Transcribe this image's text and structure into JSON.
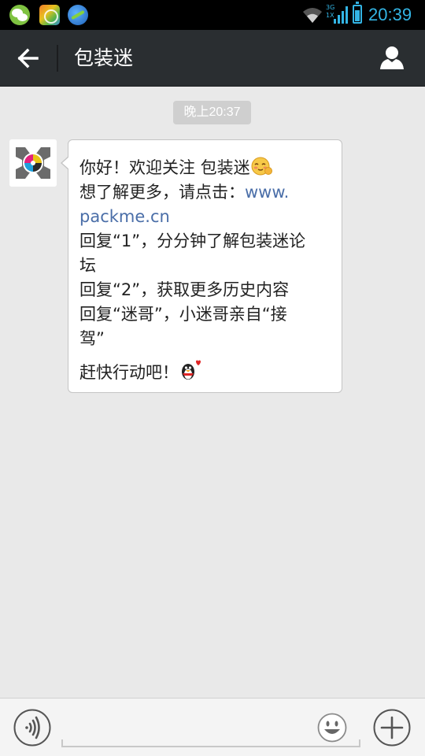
{
  "status_bar": {
    "time": "20:39",
    "network_type_top": "3G",
    "network_type_bottom": "1X",
    "icons": [
      "wechat-icon",
      "app-store-icon",
      "browser-icon",
      "wifi-icon",
      "signal-icon",
      "battery-icon"
    ]
  },
  "header": {
    "title": "包装迷",
    "back_icon": "arrow-left-icon",
    "profile_icon": "person-icon"
  },
  "chat": {
    "timestamp": "晚上20:37",
    "message": {
      "sender_avatar": "packme-logo",
      "lines": {
        "l1": "你好！欢迎关注 包装迷",
        "l2_pre": "想了解更多，请点击：",
        "l2_link": "www.",
        "l3_link": "packme.cn",
        "l4": "回复“1”，分分钟了解包装迷论",
        "l5": "坛",
        "l6": "回复“2”，获取更多历史内容",
        "l7": "回复“迷哥”，小迷哥亲自“接",
        "l8": "驾”",
        "l9": "赶快行动吧！"
      },
      "emojis": [
        "blushing-face-emoji",
        "penguin-heart-emoji"
      ]
    }
  },
  "input_bar": {
    "value": "",
    "placeholder": "",
    "voice_icon": "voice-icon",
    "emoji_icon": "smiley-icon",
    "plus_icon": "plus-icon"
  },
  "colors": {
    "title_bar": "#2a2e31",
    "chat_background": "#e9e9e9",
    "link": "#4a6ea8",
    "status_accent": "#33b5e5",
    "time_chip": "#cfcfcf"
  }
}
